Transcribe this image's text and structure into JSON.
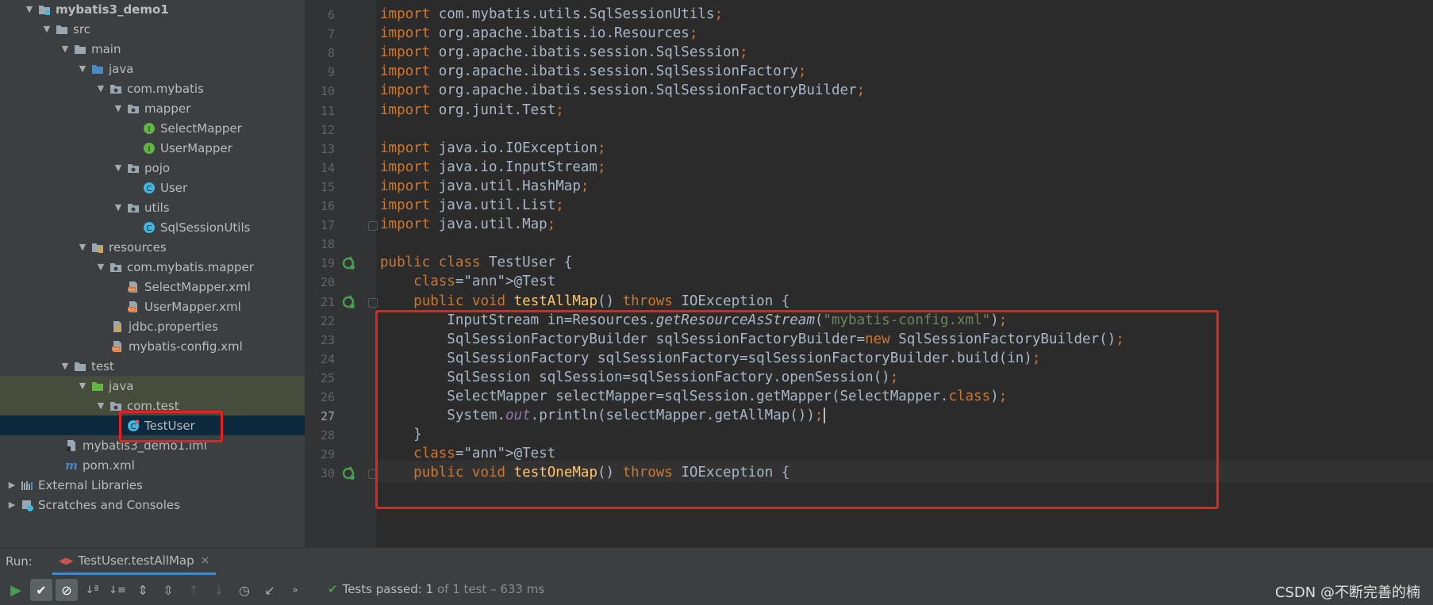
{
  "project": {
    "tree": [
      {
        "label": "mybatis3_demo1",
        "icon": "module-folder-icon",
        "arrow": "down",
        "bold": true
      },
      {
        "label": "src",
        "icon": "folder-icon",
        "arrow": "down"
      },
      {
        "label": "main",
        "icon": "folder-icon",
        "arrow": "down"
      },
      {
        "label": "java",
        "icon": "source-folder-icon",
        "arrow": "down"
      },
      {
        "label": "com.mybatis",
        "icon": "package-icon",
        "arrow": "down"
      },
      {
        "label": "mapper",
        "icon": "package-icon",
        "arrow": "down"
      },
      {
        "label": "SelectMapper",
        "icon": "interface-icon",
        "arrow": "none"
      },
      {
        "label": "UserMapper",
        "icon": "interface-icon",
        "arrow": "none"
      },
      {
        "label": "pojo",
        "icon": "package-icon",
        "arrow": "down"
      },
      {
        "label": "User",
        "icon": "class-icon",
        "arrow": "none"
      },
      {
        "label": "utils",
        "icon": "package-icon",
        "arrow": "down"
      },
      {
        "label": "SqlSessionUtils",
        "icon": "class-icon",
        "arrow": "none"
      },
      {
        "label": "resources",
        "icon": "resources-folder-icon",
        "arrow": "down"
      },
      {
        "label": "com.mybatis.mapper",
        "icon": "package-icon",
        "arrow": "down"
      },
      {
        "label": "SelectMapper.xml",
        "icon": "xml-file-icon",
        "arrow": "none"
      },
      {
        "label": "UserMapper.xml",
        "icon": "xml-file-icon",
        "arrow": "none"
      },
      {
        "label": "jdbc.properties",
        "icon": "properties-file-icon",
        "arrow": "none"
      },
      {
        "label": "mybatis-config.xml",
        "icon": "xml-file-icon",
        "arrow": "none"
      },
      {
        "label": "test",
        "icon": "folder-icon",
        "arrow": "down"
      },
      {
        "label": "java",
        "icon": "test-source-folder-icon",
        "arrow": "down"
      },
      {
        "label": "com.test",
        "icon": "package-icon",
        "arrow": "down"
      },
      {
        "label": "TestUser",
        "icon": "test-class-icon",
        "arrow": "none"
      },
      {
        "label": "mybatis3_demo1.iml",
        "icon": "iml-file-icon",
        "arrow": "none"
      },
      {
        "label": "pom.xml",
        "icon": "maven-icon",
        "arrow": "none"
      },
      {
        "label": "External Libraries",
        "icon": "libraries-icon",
        "arrow": "right"
      },
      {
        "label": "Scratches and Consoles",
        "icon": "scratches-icon",
        "arrow": "right"
      }
    ]
  },
  "editor": {
    "lines": [
      {
        "n": "6",
        "t": "import com.mybatis.utils.SqlSessionUtils;"
      },
      {
        "n": "7",
        "t": "import org.apache.ibatis.io.Resources;"
      },
      {
        "n": "8",
        "t": "import org.apache.ibatis.session.SqlSession;"
      },
      {
        "n": "9",
        "t": "import org.apache.ibatis.session.SqlSessionFactory;"
      },
      {
        "n": "10",
        "t": "import org.apache.ibatis.session.SqlSessionFactoryBuilder;"
      },
      {
        "n": "11",
        "t": "import org.junit.Test;"
      },
      {
        "n": "12",
        "t": ""
      },
      {
        "n": "13",
        "t": "import java.io.IOException;"
      },
      {
        "n": "14",
        "t": "import java.io.InputStream;"
      },
      {
        "n": "15",
        "t": "import java.util.HashMap;"
      },
      {
        "n": "16",
        "t": "import java.util.List;"
      },
      {
        "n": "17",
        "t": "import java.util.Map;"
      },
      {
        "n": "18",
        "t": ""
      },
      {
        "n": "19",
        "t": "public class TestUser {"
      },
      {
        "n": "20",
        "t": "    @Test"
      },
      {
        "n": "21",
        "t": "    public void testAllMap() throws IOException {"
      },
      {
        "n": "22",
        "t": "        InputStream in=Resources.getResourceAsStream(\"mybatis-config.xml\");"
      },
      {
        "n": "23",
        "t": "        SqlSessionFactoryBuilder sqlSessionFactoryBuilder=new SqlSessionFactoryBuilder();"
      },
      {
        "n": "24",
        "t": "        SqlSessionFactory sqlSessionFactory=sqlSessionFactoryBuilder.build(in);"
      },
      {
        "n": "25",
        "t": "        SqlSession sqlSession=sqlSessionFactory.openSession();"
      },
      {
        "n": "26",
        "t": "        SelectMapper selectMapper=sqlSession.getMapper(SelectMapper.class);"
      },
      {
        "n": "27",
        "t": "        System.out.println(selectMapper.getAllMap());"
      },
      {
        "n": "28",
        "t": "    }"
      },
      {
        "n": "29",
        "t": "    @Test"
      },
      {
        "n": "30",
        "t": "    public void testOneMap() throws IOException {"
      }
    ]
  },
  "run": {
    "label": "Run:",
    "tab_label": "TestUser.testAllMap",
    "status_prefix": "Tests passed:",
    "status_count": "1",
    "status_rest": "of 1 test – 633 ms"
  },
  "watermark": "CSDN @不断完善的楠",
  "colors": {
    "highlight_box": "#e8201f",
    "pass_green": "#499c54",
    "keyword": "#cc7832",
    "string": "#6a8759",
    "annotation": "#bbb529",
    "method": "#ffc66d"
  }
}
